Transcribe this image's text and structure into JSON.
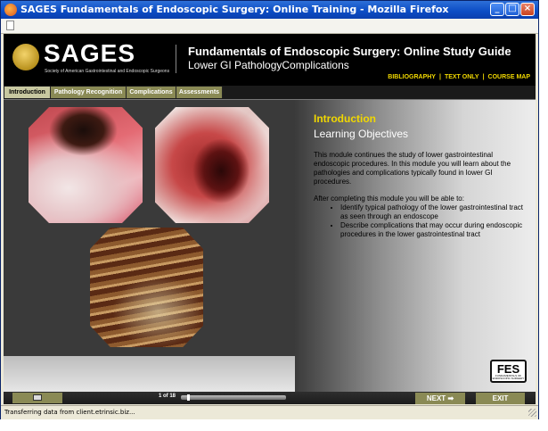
{
  "window": {
    "title": "SAGES Fundamentals of Endoscopic Surgery: Online Training - Mozilla Firefox"
  },
  "header": {
    "logo_text": "SAGES",
    "logo_subtitle": "Society of American Gastrointestinal and Endoscopic Surgeons",
    "title": "Fundamentals of Endoscopic Surgery: Online Study Guide",
    "subtitle": "Lower GI PathologyComplications",
    "links": [
      "BIBLIOGRAPHY",
      "TEXT ONLY",
      "COURSE MAP"
    ]
  },
  "nav": {
    "tabs": [
      "Introduction",
      "Pathology Recognition",
      "Complications",
      "Assessments"
    ],
    "active": "Introduction"
  },
  "content": {
    "heading": "Introduction",
    "subheading": "Learning Objectives",
    "paragraph1": "This module continues the study of lower gastrointestinal endoscopic procedures. In this module you will learn about the pathologies and complications typically found in lower GI procedures.",
    "paragraph2": "After completing this module you will be able to:",
    "objectives": [
      "Identify typical pathology of the lower gastrointestinal tract as seen through an endoscope",
      "Describe complications that may occur during endoscopic procedures in the lower gastrointestinal tract"
    ],
    "badge_text": "FES",
    "badge_subtext": "FUNDAMENTALS OF ENDOSCOPIC SURGERY"
  },
  "footer": {
    "page_indicator": "1 of 18",
    "progress": 0.06,
    "next_label": "NEXT",
    "exit_label": "EXIT"
  },
  "status": {
    "text": "Transferring data from client.etrinsic.biz..."
  },
  "icons": {
    "browser": "firefox-icon",
    "print": "printer-icon",
    "next_arrow": "arrow-right-icon",
    "page": "page-icon"
  }
}
